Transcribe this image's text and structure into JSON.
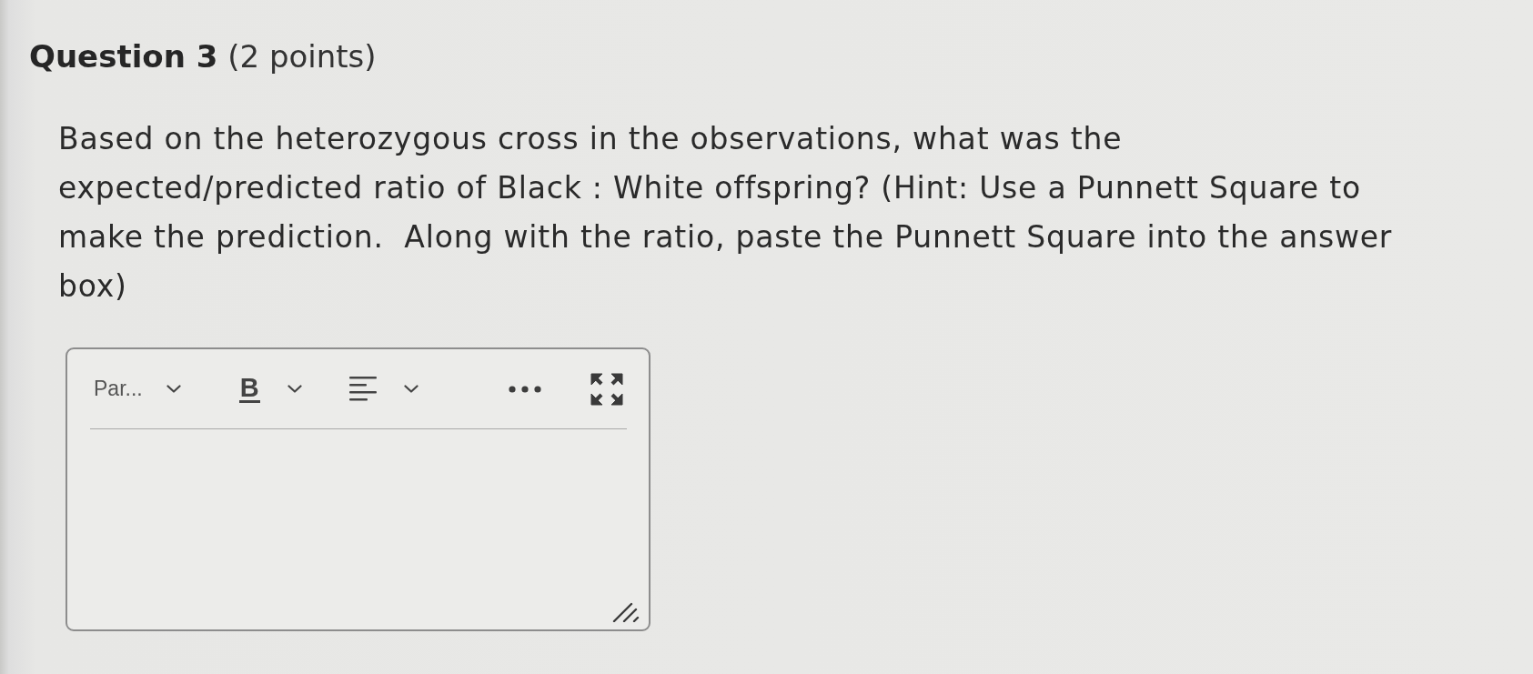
{
  "question": {
    "title": "**Question 3** (2 points)",
    "prompt": "Based on the heterozygous cross in the observations, what was the expected/predicted ratio of Black : White offspring? (Hint: Use a Punnett Square to make the prediction.  Along with the ratio, paste the Punnett Square into the answer box)"
  },
  "editor": {
    "toolbar": [
      {
        "kind": "block-format",
        "label": "Par...",
        "dropdown": true
      },
      {
        "kind": "bold",
        "label": "B",
        "dropdown": true
      },
      {
        "kind": "align",
        "dropdown": true
      },
      {
        "kind": "more"
      },
      {
        "kind": "fullscreen"
      }
    ],
    "resizable": true
  }
}
